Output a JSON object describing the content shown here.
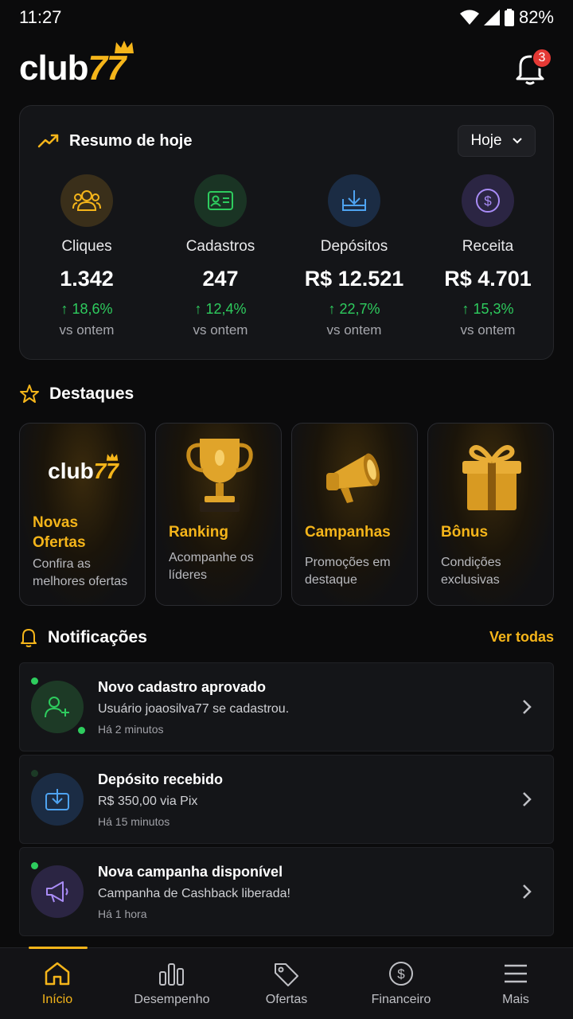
{
  "status_bar": {
    "time": "11:27",
    "battery": "82%"
  },
  "header": {
    "logo_text": "club",
    "logo_number": "77",
    "notification_count": "3"
  },
  "summary": {
    "title": "Resumo de hoje",
    "period": "Hoje",
    "stats": [
      {
        "label": "Cliques",
        "value": "1.342",
        "change": "↑ 18,6%",
        "sub": "vs ontem",
        "icon": "users-icon",
        "color": "#f5b51a"
      },
      {
        "label": "Cadastros",
        "value": "247",
        "change": "↑ 12,4%",
        "sub": "vs ontem",
        "icon": "id-card-icon",
        "color": "#2ecc5e"
      },
      {
        "label": "Depósitos",
        "value": "R$ 12.521",
        "change": "↑ 22,7%",
        "sub": "vs ontem",
        "icon": "download-tray-icon",
        "color": "#4ea3f1"
      },
      {
        "label": "Receita",
        "value": "R$ 4.701",
        "change": "↑ 15,3%",
        "sub": "vs ontem",
        "icon": "dollar-circle-icon",
        "color": "#a98cf7"
      }
    ]
  },
  "highlights": {
    "title": "Destaques",
    "cards": [
      {
        "title": "Novas Ofertas",
        "desc": "Confira as melhores ofertas",
        "art_logo": "club",
        "art_num": "77"
      },
      {
        "title": "Ranking",
        "desc": "Acompanhe os líderes"
      },
      {
        "title": "Campanhas",
        "desc": "Promoções em destaque"
      },
      {
        "title": "Bônus",
        "desc": "Condições exclusivas"
      }
    ]
  },
  "notifications": {
    "title": "Notificações",
    "see_all": "Ver todas",
    "items": [
      {
        "title": "Novo cadastro aprovado",
        "text": "Usuário joaosilva77 se cadastrou.",
        "time": "Há 2 minutos",
        "icon": "user-plus-icon"
      },
      {
        "title": "Depósito recebido",
        "text": "R$ 350,00 via Pix",
        "time": "Há 15 minutos",
        "icon": "deposit-icon"
      },
      {
        "title": "Nova campanha disponível",
        "text": "Campanha de Cashback liberada!",
        "time": "Há 1 hora",
        "icon": "megaphone-icon"
      }
    ]
  },
  "tabbar": {
    "items": [
      {
        "label": "Início",
        "icon": "home-icon",
        "active": true
      },
      {
        "label": "Desempenho",
        "icon": "bar-chart-icon"
      },
      {
        "label": "Ofertas",
        "icon": "tag-icon"
      },
      {
        "label": "Financeiro",
        "icon": "dollar-icon"
      },
      {
        "label": "Mais",
        "icon": "menu-icon"
      }
    ]
  }
}
